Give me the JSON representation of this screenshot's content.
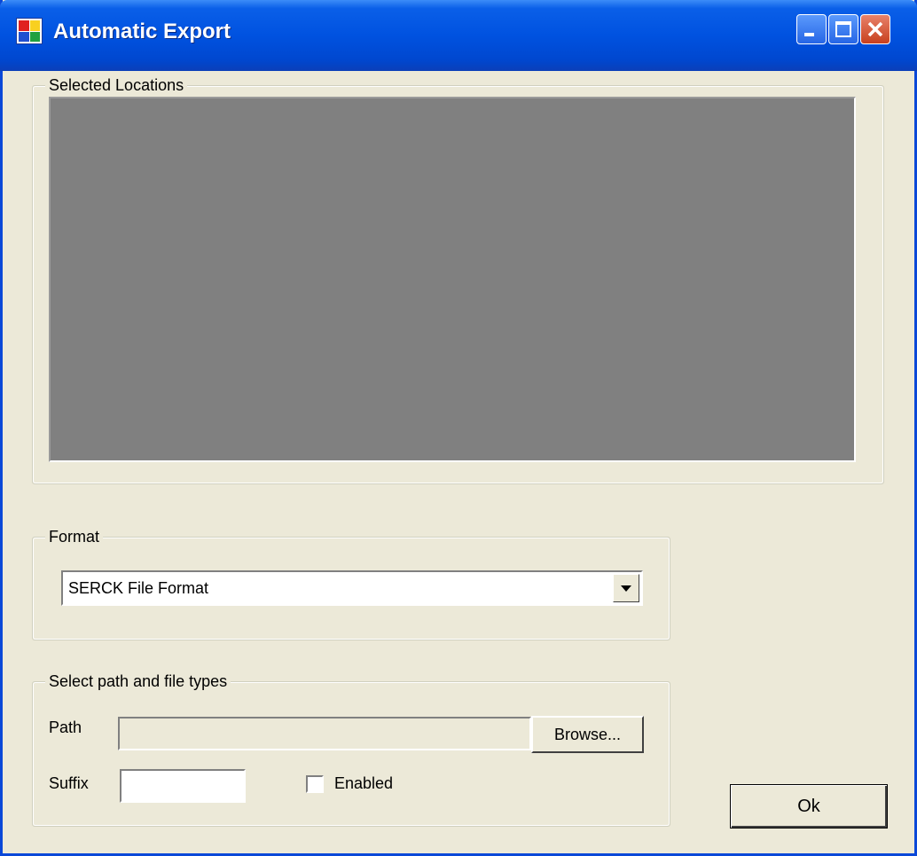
{
  "window": {
    "title": "Automatic Export",
    "icon": "app-window-icon",
    "controls": [
      "minimize-icon",
      "maximize-icon",
      "close-icon"
    ]
  },
  "locations_group": {
    "legend": "Selected Locations"
  },
  "format_group": {
    "legend": "Format",
    "selected": "SERCK File Format"
  },
  "path_group": {
    "legend": "Select path and file types",
    "path_label": "Path",
    "path_value": "",
    "browse_label": "Browse...",
    "suffix_label": "Suffix",
    "suffix_value": "",
    "enabled_label": "Enabled",
    "enabled_checked": false
  },
  "ok_label": "Ok",
  "colors": {
    "title_blue": "#0052e0",
    "dialog_bg": "#ece9d8",
    "list_bg": "#808080",
    "close_red": "#c8401e"
  }
}
